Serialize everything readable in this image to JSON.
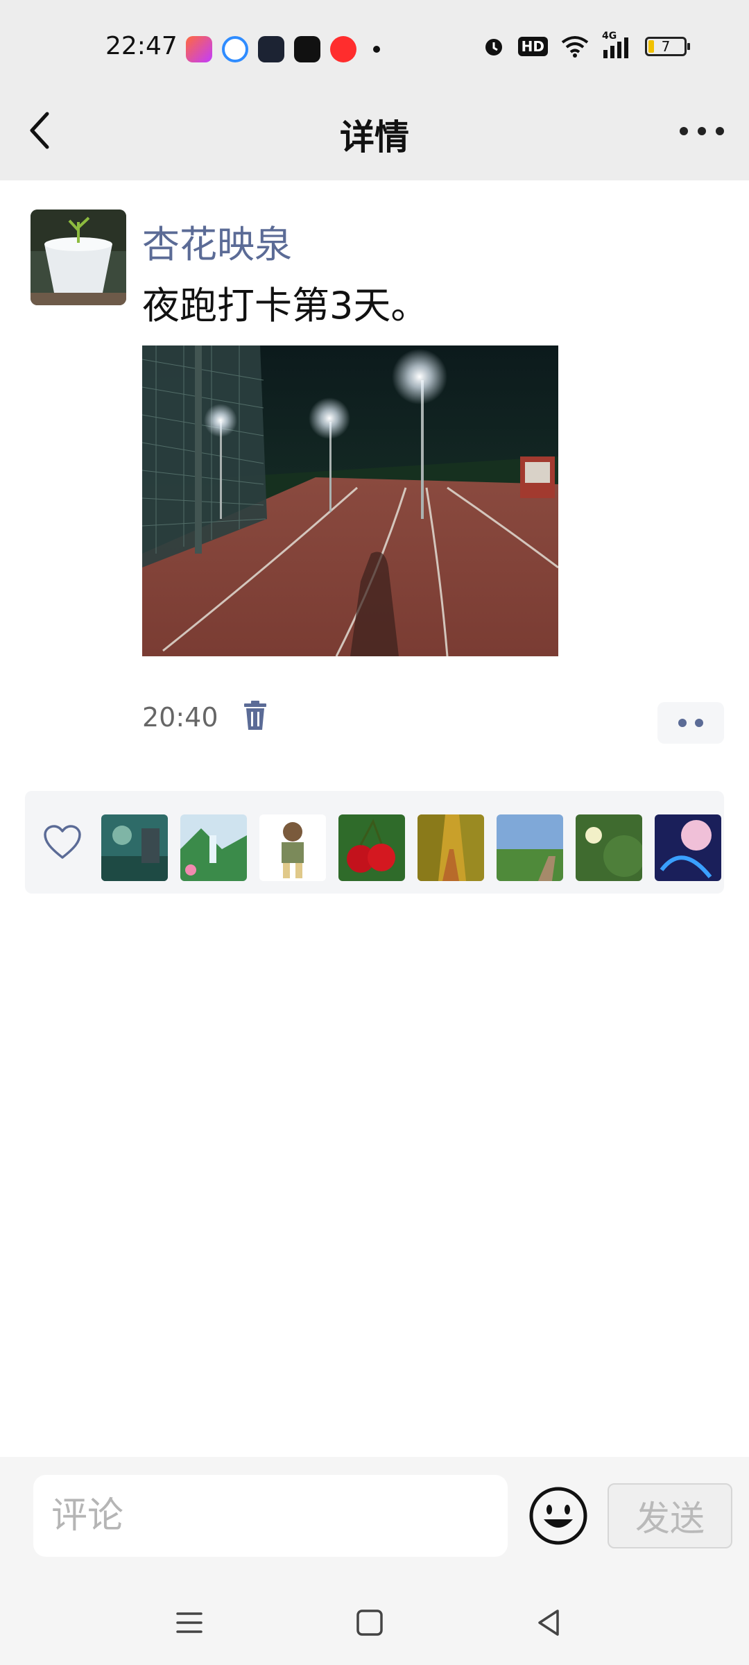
{
  "status_bar": {
    "time": "22:47",
    "battery": "7",
    "network": "4G",
    "hd": "HD"
  },
  "header": {
    "title": "详情"
  },
  "post": {
    "username": "杏花映泉",
    "text": "夜跑打卡第3天。",
    "time": "20:40"
  },
  "likes": {
    "icon": "heart-outline-icon",
    "count_avatars": 8
  },
  "comment_bar": {
    "placeholder": "评论",
    "send_label": "发送"
  },
  "colors": {
    "username": "#5b6b96",
    "header_bg": "#ededed",
    "likes_bg": "#f4f5f7"
  }
}
